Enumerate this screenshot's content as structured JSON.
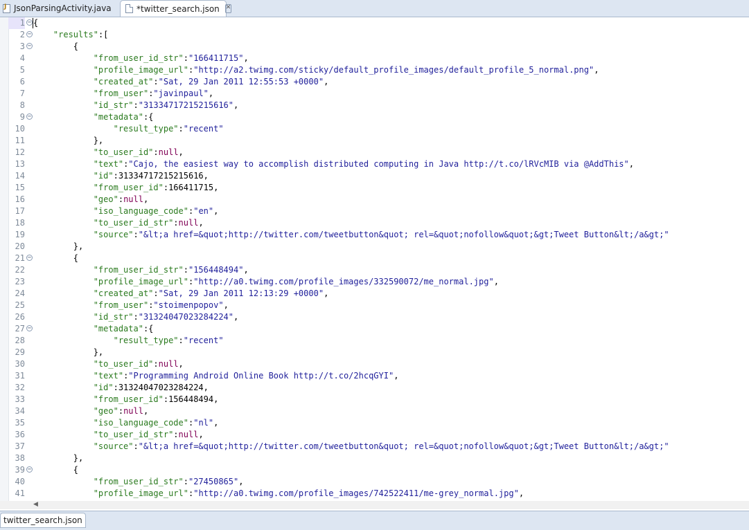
{
  "tabs": [
    {
      "label": "JsonParsingActivity.java"
    },
    {
      "label": "*twitter_search.json"
    }
  ],
  "bottom_tab": {
    "label": "twitter_search.json"
  },
  "editor": {
    "lines": [
      {
        "n": "1",
        "fold": true,
        "t": "{"
      },
      {
        "n": "2",
        "fold": true,
        "t": "    \"results\":["
      },
      {
        "n": "3",
        "fold": true,
        "t": "        {"
      },
      {
        "n": "4",
        "fold": false,
        "t": "            \"from_user_id_str\":\"166411715\","
      },
      {
        "n": "5",
        "fold": false,
        "t": "            \"profile_image_url\":\"http://a2.twimg.com/sticky/default_profile_images/default_profile_5_normal.png\","
      },
      {
        "n": "6",
        "fold": false,
        "t": "            \"created_at\":\"Sat, 29 Jan 2011 12:55:53 +0000\","
      },
      {
        "n": "7",
        "fold": false,
        "t": "            \"from_user\":\"javinpaul\","
      },
      {
        "n": "8",
        "fold": false,
        "t": "            \"id_str\":\"31334717215215616\","
      },
      {
        "n": "9",
        "fold": true,
        "t": "            \"metadata\":{"
      },
      {
        "n": "10",
        "fold": false,
        "t": "                \"result_type\":\"recent\""
      },
      {
        "n": "11",
        "fold": false,
        "t": "            },"
      },
      {
        "n": "12",
        "fold": false,
        "t": "            \"to_user_id\":null,"
      },
      {
        "n": "13",
        "fold": false,
        "t": "            \"text\":\"Cajo, the easiest way to accomplish distributed computing in Java http://t.co/lRVcMIB via @AddThis\","
      },
      {
        "n": "14",
        "fold": false,
        "t": "            \"id\":31334717215215616,"
      },
      {
        "n": "15",
        "fold": false,
        "t": "            \"from_user_id\":166411715,"
      },
      {
        "n": "16",
        "fold": false,
        "t": "            \"geo\":null,"
      },
      {
        "n": "17",
        "fold": false,
        "t": "            \"iso_language_code\":\"en\","
      },
      {
        "n": "18",
        "fold": false,
        "t": "            \"to_user_id_str\":null,"
      },
      {
        "n": "19",
        "fold": false,
        "t": "            \"source\":\"&lt;a href=&quot;http://twitter.com/tweetbutton&quot; rel=&quot;nofollow&quot;&gt;Tweet Button&lt;/a&gt;\""
      },
      {
        "n": "20",
        "fold": false,
        "t": "        },"
      },
      {
        "n": "21",
        "fold": true,
        "t": "        {"
      },
      {
        "n": "22",
        "fold": false,
        "t": "            \"from_user_id_str\":\"156448494\","
      },
      {
        "n": "23",
        "fold": false,
        "t": "            \"profile_image_url\":\"http://a0.twimg.com/profile_images/332590072/me_normal.jpg\","
      },
      {
        "n": "24",
        "fold": false,
        "t": "            \"created_at\":\"Sat, 29 Jan 2011 12:13:29 +0000\","
      },
      {
        "n": "25",
        "fold": false,
        "t": "            \"from_user\":\"stoimenpopov\","
      },
      {
        "n": "26",
        "fold": false,
        "t": "            \"id_str\":\"31324047023284224\","
      },
      {
        "n": "27",
        "fold": true,
        "t": "            \"metadata\":{"
      },
      {
        "n": "28",
        "fold": false,
        "t": "                \"result_type\":\"recent\""
      },
      {
        "n": "29",
        "fold": false,
        "t": "            },"
      },
      {
        "n": "30",
        "fold": false,
        "t": "            \"to_user_id\":null,"
      },
      {
        "n": "31",
        "fold": false,
        "t": "            \"text\":\"Programming Android Online Book http://t.co/2hcqGYI\","
      },
      {
        "n": "32",
        "fold": false,
        "t": "            \"id\":31324047023284224,"
      },
      {
        "n": "33",
        "fold": false,
        "t": "            \"from_user_id\":156448494,"
      },
      {
        "n": "34",
        "fold": false,
        "t": "            \"geo\":null,"
      },
      {
        "n": "35",
        "fold": false,
        "t": "            \"iso_language_code\":\"nl\","
      },
      {
        "n": "36",
        "fold": false,
        "t": "            \"to_user_id_str\":null,"
      },
      {
        "n": "37",
        "fold": false,
        "t": "            \"source\":\"&lt;a href=&quot;http://twitter.com/tweetbutton&quot; rel=&quot;nofollow&quot;&gt;Tweet Button&lt;/a&gt;\""
      },
      {
        "n": "38",
        "fold": false,
        "t": "        },"
      },
      {
        "n": "39",
        "fold": true,
        "t": "        {"
      },
      {
        "n": "40",
        "fold": false,
        "t": "            \"from_user_id_str\":\"27450865\","
      },
      {
        "n": "41",
        "fold": false,
        "t": "            \"profile_image_url\":\"http://a0.twimg.com/profile_images/742522411/me-grey_normal.jpg\","
      }
    ]
  }
}
